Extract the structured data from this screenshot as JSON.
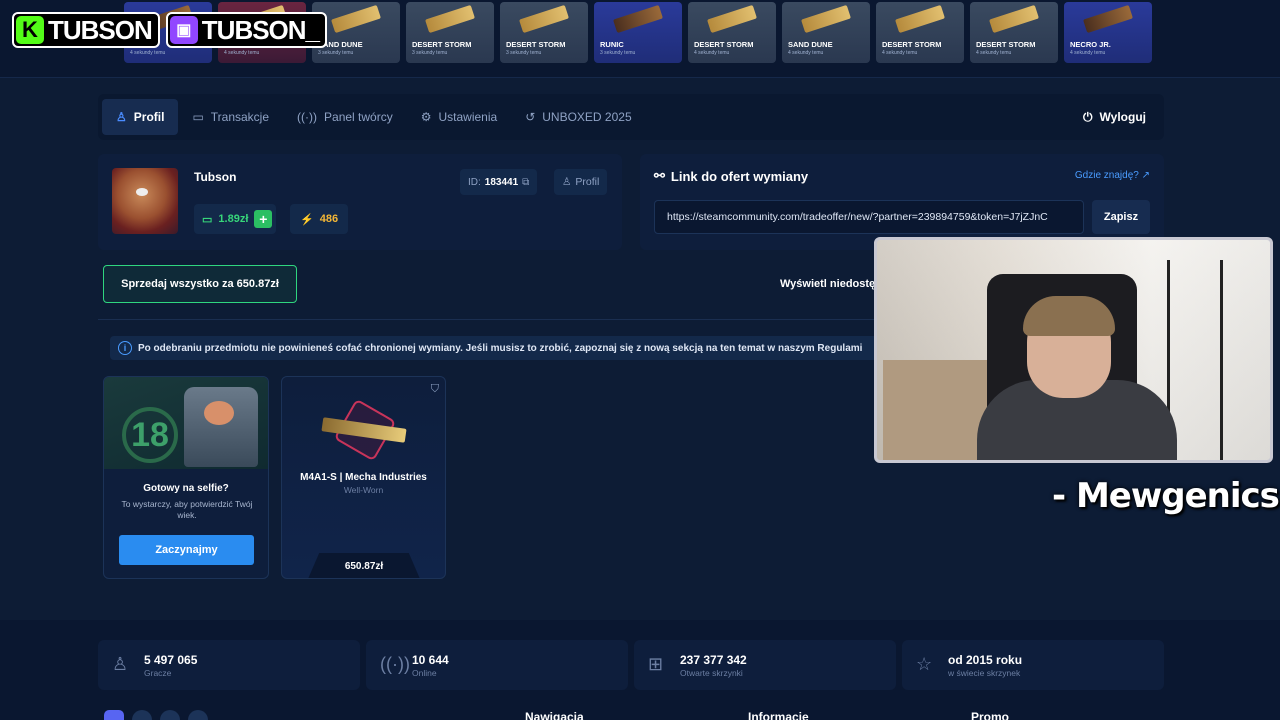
{
  "streamer_badges": [
    {
      "platform": "kick-icon",
      "logo": "K",
      "name": "TUBSON"
    },
    {
      "platform": "twitch-icon",
      "logo": "▣",
      "name": "TUBSON_"
    }
  ],
  "live_drops": [
    {
      "name": "RO",
      "sub": "4 sekundy temu",
      "tone": "blue"
    },
    {
      "name": "",
      "sub": "4 sekundy temu",
      "tone": "red"
    },
    {
      "name": "SAND DUNE",
      "sub": "3 sekundy temu",
      "tone": "grey"
    },
    {
      "name": "DESERT STORM",
      "sub": "3 sekundy temu",
      "tone": "grey"
    },
    {
      "name": "DESERT STORM",
      "sub": "3 sekundy temu",
      "tone": "grey"
    },
    {
      "name": "RUNIC",
      "sub": "3 sekundy temu",
      "tone": "blue"
    },
    {
      "name": "DESERT STORM",
      "sub": "4 sekundy temu",
      "tone": "grey"
    },
    {
      "name": "SAND DUNE",
      "sub": "4 sekundy temu",
      "tone": "grey"
    },
    {
      "name": "DESERT STORM",
      "sub": "4 sekundy temu",
      "tone": "grey"
    },
    {
      "name": "DESERT STORM",
      "sub": "4 sekundy temu",
      "tone": "grey"
    },
    {
      "name": "NECRO JR.",
      "sub": "4 sekundy temu",
      "tone": "blue"
    }
  ],
  "tabs": [
    {
      "label": "Profil",
      "icon": "user-icon",
      "glyph": "♙",
      "active": true
    },
    {
      "label": "Transakcje",
      "icon": "wallet-icon",
      "glyph": "▭"
    },
    {
      "label": "Panel twórcy",
      "icon": "broadcast-icon",
      "glyph": "((·))"
    },
    {
      "label": "Ustawienia",
      "icon": "gear-icon",
      "glyph": "⚙"
    },
    {
      "label": "UNBOXED 2025",
      "icon": "history-icon",
      "glyph": "↺"
    }
  ],
  "logout": {
    "label": "Wyloguj",
    "glyph": "⏻"
  },
  "profile": {
    "username": "Tubson",
    "id_label": "ID:",
    "id_value": "183441",
    "profile_button": "Profil",
    "balance": "1.89zł",
    "coins": "486"
  },
  "trade_link": {
    "title": "Link do ofert wymiany",
    "where_link": "Gdzie znajdę?",
    "url": "https://steamcommunity.com/tradeoffer/new/?partner=239894759&token=J7jZJnC",
    "save_label": "Zapisz"
  },
  "sell_all": "Sprzedaj wszystko za 650.87zł",
  "show_unavailable": "Wyświetl niedostę",
  "notice": "Po odebraniu przedmiotu nie powinieneś cofać chronionej wymiany. Jeśli musisz to zrobić, zapoznaj się z nową sekcją na ten temat w naszym Regulami",
  "selfie_card": {
    "age": "18",
    "title": "Gotowy na selfie?",
    "text": "To wystarczy, aby potwierdzić Twój wiek.",
    "button": "Zaczynajmy"
  },
  "item_card": {
    "name": "M4A1-S | Mecha Industries",
    "condition": "Well-Worn",
    "price": "650.87zł"
  },
  "stream_overlay": "- Mewgenics",
  "stats": [
    {
      "value": "5 497 065",
      "label": "Gracze",
      "icon": "user-icon",
      "glyph": "♙"
    },
    {
      "value": "10 644",
      "label": "Online",
      "icon": "broadcast-icon",
      "glyph": "((·))"
    },
    {
      "value": "237 377 342",
      "label": "Otwarte skrzynki",
      "icon": "case-icon",
      "glyph": "⊞"
    },
    {
      "value": "od 2015 roku",
      "label": "w świecie skrzynek",
      "icon": "star-icon",
      "glyph": "☆"
    }
  ],
  "footer": {
    "nav": "Nawigacja",
    "info": "Informacje",
    "promo": "Promo"
  }
}
